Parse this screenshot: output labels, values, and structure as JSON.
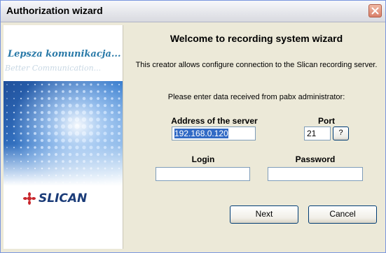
{
  "window": {
    "title": "Authorization wizard"
  },
  "banner": {
    "slogan": "Lepsza komunikacja...",
    "slogan_en": "Better Communication...",
    "logo_text": "SLICAN",
    "colors": {
      "slogan": "#2a7aa8",
      "logo": "#1a3b78",
      "dots": "#3a7ecb",
      "star": "#c8262c"
    }
  },
  "content": {
    "heading": "Welcome to recording system wizard",
    "description": "This creator allows configure connection to the Slican recording server.",
    "prompt": "Please enter data received from pabx administrator:"
  },
  "form": {
    "server_label": "Address of the server",
    "server_value": "192.168.0.120",
    "port_label": "Port",
    "port_value": "21",
    "help_label": "?",
    "login_label": "Login",
    "login_value": "",
    "password_label": "Password",
    "password_value": ""
  },
  "buttons": {
    "next": "Next",
    "cancel": "Cancel"
  }
}
